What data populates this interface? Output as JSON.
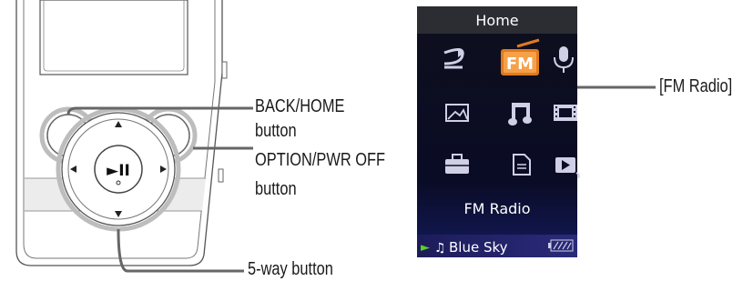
{
  "callouts": {
    "back_home": "BACK/HOME",
    "back_home_2": "button",
    "option_pwr": "OPTION/PWR OFF",
    "option_pwr_2": "button",
    "five_way": "5-way button",
    "fm_radio": "[FM Radio]"
  },
  "device": {
    "play_pause_glyph": "►II"
  },
  "screen": {
    "title": "Home",
    "fm_icon_label": "FM",
    "selected_label": "FM Radio",
    "status_song": "Blue Sky",
    "status_play_glyph": "►",
    "status_note_glyph": "♫"
  },
  "icons": [
    "shuffle-icon",
    "fm-radio-icon",
    "microphone-icon",
    "photo-icon",
    "music-icon",
    "video-icon",
    "settings-briefcase-icon",
    "document-icon",
    "now-playing-icon"
  ],
  "colors": {
    "screen_bg": "#0a0c24",
    "screen_title_bg": "#2c2d33",
    "fm_icon_orange": "#e07a1f",
    "status_bar_bg": "#20206e",
    "status_play_green": "#5ad21e"
  }
}
